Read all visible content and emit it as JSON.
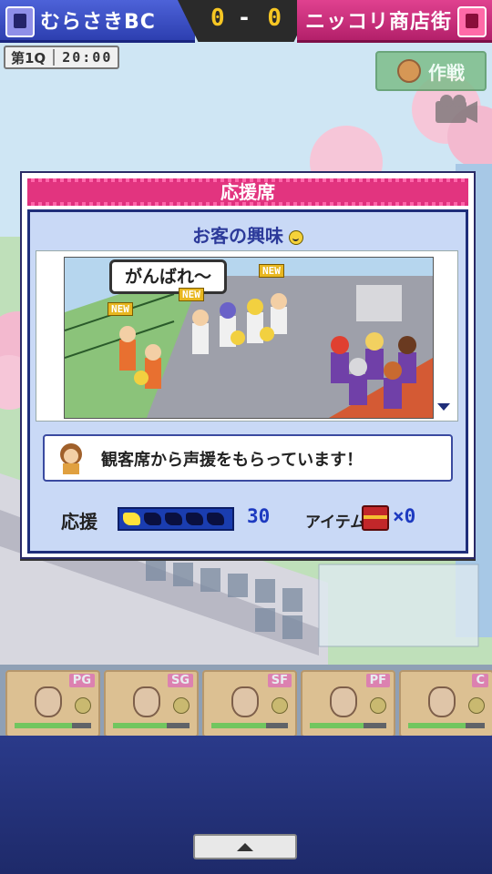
{
  "scoreboard": {
    "home_team": "むらさきBC",
    "away_team": "ニッコリ商店街",
    "home_score": "0",
    "separator": "-",
    "away_score": "0",
    "quarter": "第1Q",
    "clock": "20:00"
  },
  "strategy_button": {
    "label": "作戦",
    "icon": "basketball-icon"
  },
  "camera_button": {
    "icon": "camera-icon"
  },
  "dialog": {
    "title": "応援席",
    "section_title": "お客の興味",
    "speech_bubble": "がんばれ〜",
    "new_tags": [
      "NEW",
      "NEW",
      "NEW"
    ],
    "message": "観客席から声援をもらっています！",
    "cheer": {
      "label": "応援",
      "level": 1,
      "max_level": 5,
      "value": "30"
    },
    "item": {
      "label": "アイテム",
      "icon": "treasure-chest-icon",
      "value": "×0"
    }
  },
  "player_cards": [
    {
      "position": "PG",
      "stamina": 0.75
    },
    {
      "position": "SG",
      "stamina": 0.7
    },
    {
      "position": "SF",
      "stamina": 0.72
    },
    {
      "position": "PF",
      "stamina": 0.7
    },
    {
      "position": "C",
      "stamina": 0.75
    }
  ],
  "colors": {
    "home": "#3b4fc8",
    "away": "#d02c7e",
    "score": "#f6c623"
  }
}
